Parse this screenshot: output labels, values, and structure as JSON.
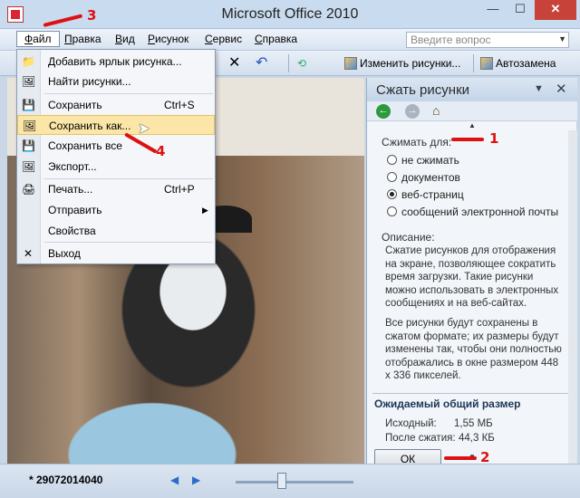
{
  "window": {
    "title": "Microsoft Office 2010"
  },
  "menubar": {
    "items": [
      {
        "label": "Файл",
        "ul": "Ф",
        "rest": "айл"
      },
      {
        "label": "Правка",
        "ul": "П",
        "rest": "равка"
      },
      {
        "label": "Вид",
        "ul": "В",
        "rest": "ид"
      },
      {
        "label": "Рисунок",
        "ul": "Р",
        "rest": "исунок"
      },
      {
        "label": "Сервис",
        "ul": "С",
        "rest": "ервис"
      },
      {
        "label": "Справка",
        "ul": "С",
        "rest": "правка"
      }
    ],
    "help_placeholder": "Введите вопрос"
  },
  "toolbar": {
    "edit_pictures": "Изменить рисунки...",
    "autocorrect": "Автозамена"
  },
  "file_menu": {
    "items": [
      {
        "label": "Добавить ярлык рисунка...",
        "icon": "add-shortcut-icon"
      },
      {
        "label": "Найти рисунки...",
        "icon": "find-pictures-icon"
      },
      {
        "label": "Сохранить",
        "shortcut": "Ctrl+S",
        "icon": "save-icon"
      },
      {
        "label": "Сохранить как...",
        "icon": "save-as-icon"
      },
      {
        "label": "Сохранить все",
        "icon": "save-all-icon"
      },
      {
        "label": "Экспорт...",
        "icon": "export-icon"
      },
      {
        "label": "Печать...",
        "shortcut": "Ctrl+P",
        "icon": "print-icon"
      },
      {
        "label": "Отправить",
        "icon": "send-icon"
      },
      {
        "label": "Свойства",
        "icon": "properties-icon"
      },
      {
        "label": "Выход",
        "icon": "exit-icon"
      }
    ]
  },
  "task_pane": {
    "title": "Сжать рисунки",
    "compress_for_label": "Сжимать для:",
    "options": [
      {
        "label": "не сжимать",
        "selected": false
      },
      {
        "label": "документов",
        "selected": false
      },
      {
        "label": "веб-страниц",
        "selected": true
      },
      {
        "label": "сообщений электронной почты",
        "selected": false
      }
    ],
    "description_label": "Описание:",
    "description_p1": "Сжатие рисунков для отображения на экране, позволяющее сократить время загрузки. Такие рисунки можно использовать в электронных сообщениях и на веб-сайтах.",
    "description_p2": "Все рисунки будут сохранены в сжатом формате; их размеры будут изменены так, чтобы они полностью отображались в окне размером 448 x 336 пикселей.",
    "expected_size_heading": "Ожидаемый общий размер",
    "original_label": "Исходный:",
    "original_value": "1,55 МБ",
    "after_label": "После сжатия:",
    "after_value": "44,3 КБ",
    "ok_label": "ОК"
  },
  "status": {
    "filename": "* 29072014040"
  },
  "annotations": {
    "a1": "1",
    "a2": "2",
    "a3": "3",
    "a4": "4"
  },
  "colors": {
    "annotation": "#dd1111",
    "highlight": "#fbe6a8",
    "titlebar": "#c9dbee"
  }
}
